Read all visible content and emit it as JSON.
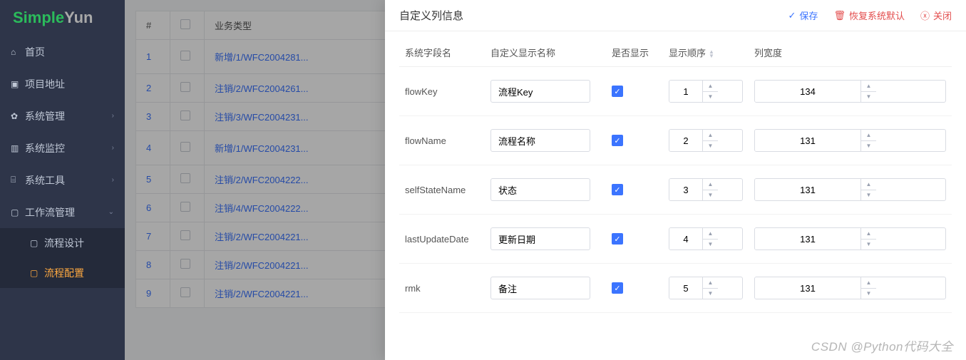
{
  "logo": {
    "part1": "Simple",
    "part2": "Yun"
  },
  "sidebar": {
    "items": [
      {
        "label": "首页",
        "icon": "⌂",
        "expand": null
      },
      {
        "label": "项目地址",
        "icon": "▣",
        "expand": null
      },
      {
        "label": "系统管理",
        "icon": "✿",
        "expand": "›"
      },
      {
        "label": "系统监控",
        "icon": "▥",
        "expand": "›"
      },
      {
        "label": "系统工具",
        "icon": "⌸",
        "expand": "›"
      },
      {
        "label": "工作流管理",
        "icon": "▢",
        "expand": "⌄"
      }
    ],
    "subitems": [
      {
        "label": "流程设计",
        "active": false
      },
      {
        "label": "流程配置",
        "active": true
      }
    ]
  },
  "table": {
    "headers": {
      "idx": "#",
      "type": "业务类型"
    },
    "rows": [
      {
        "idx": "1",
        "type": "新增/1/WFC2004281...",
        "btn": true
      },
      {
        "idx": "2",
        "type": "注销/2/WFC2004261..."
      },
      {
        "idx": "3",
        "type": "注销/3/WFC2004231..."
      },
      {
        "idx": "4",
        "type": "新增/1/WFC2004231...",
        "btn": true
      },
      {
        "idx": "5",
        "type": "注销/2/WFC2004222..."
      },
      {
        "idx": "6",
        "type": "注销/4/WFC2004222..."
      },
      {
        "idx": "7",
        "type": "注销/2/WFC2004221..."
      },
      {
        "idx": "8",
        "type": "注销/2/WFC2004221..."
      },
      {
        "idx": "9",
        "type": "注销/2/WFC2004221..."
      }
    ]
  },
  "drawer": {
    "title": "自定义列信息",
    "actions": {
      "save": "保存",
      "restore": "恢复系统默认",
      "close": "关闭"
    },
    "headers": {
      "field": "系统字段名",
      "display": "自定义显示名称",
      "show": "是否显示",
      "order": "显示顺序",
      "width": "列宽度"
    },
    "rows": [
      {
        "field": "flowKey",
        "display": "流程Key",
        "show": true,
        "order": "1",
        "width": "134"
      },
      {
        "field": "flowName",
        "display": "流程名称",
        "show": true,
        "order": "2",
        "width": "131"
      },
      {
        "field": "selfStateName",
        "display": "状态",
        "show": true,
        "order": "3",
        "width": "131"
      },
      {
        "field": "lastUpdateDate",
        "display": "更新日期",
        "show": true,
        "order": "4",
        "width": "131"
      },
      {
        "field": "rmk",
        "display": "备注",
        "show": true,
        "order": "5",
        "width": "131"
      }
    ]
  },
  "watermark": "CSDN @Python代码大全"
}
